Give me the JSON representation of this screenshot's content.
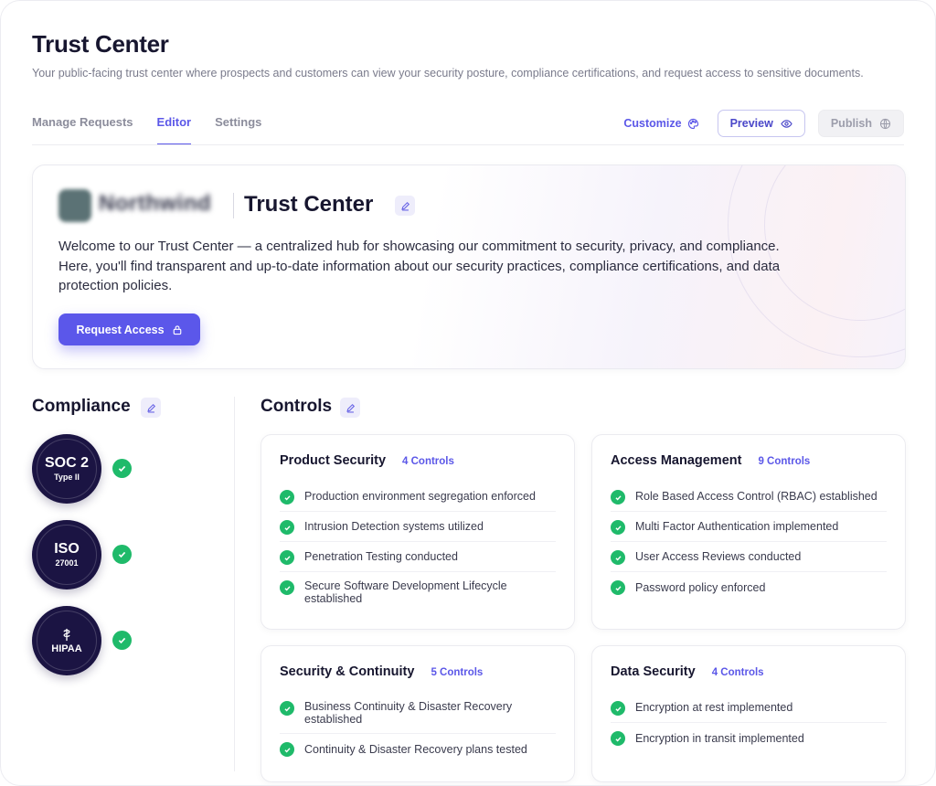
{
  "header": {
    "title": "Trust Center",
    "subtitle": "Your public-facing trust center where prospects and customers can view your security posture, compliance certifications, and request access to sensitive documents."
  },
  "tabs": [
    {
      "label": "Manage Requests",
      "active": false
    },
    {
      "label": "Editor",
      "active": true
    },
    {
      "label": "Settings",
      "active": false
    }
  ],
  "toolbar": {
    "customize_label": "Customize",
    "preview_label": "Preview",
    "publish_label": "Publish"
  },
  "hero": {
    "brand_name": "Northwind",
    "title": "Trust Center",
    "description": "Welcome to our Trust Center — a centralized hub for showcasing our commitment to security, privacy, and compliance. Here, you'll find transparent and up-to-date information about our security practices, compliance certifications, and data protection policies.",
    "cta_label": "Request Access"
  },
  "compliance": {
    "heading": "Compliance",
    "badges": [
      {
        "main": "SOC 2",
        "sub": "Type II",
        "verified": true
      },
      {
        "main": "ISO",
        "sub": "27001",
        "verified": true
      },
      {
        "main": "HIPAA",
        "sub": "",
        "verified": true
      }
    ]
  },
  "controls": {
    "heading": "Controls",
    "cards": [
      {
        "title": "Product Security",
        "count": "4 Controls",
        "items": [
          "Production environment segregation enforced",
          "Intrusion Detection systems utilized",
          "Penetration Testing conducted",
          "Secure Software Development Lifecycle established"
        ]
      },
      {
        "title": "Access Management",
        "count": "9 Controls",
        "items": [
          "Role Based Access Control (RBAC) established",
          "Multi Factor Authentication implemented",
          "User Access Reviews conducted",
          "Password policy enforced"
        ]
      },
      {
        "title": "Security & Continuity",
        "count": "5 Controls",
        "items": [
          "Business Continuity & Disaster Recovery established",
          "Continuity & Disaster Recovery plans tested"
        ]
      },
      {
        "title": "Data Security",
        "count": "4 Controls",
        "items": [
          "Encryption at rest implemented",
          "Encryption in transit implemented"
        ]
      }
    ]
  },
  "colors": {
    "accent": "#5b57e8",
    "badge_bg": "#1b1443",
    "success": "#1fba6a"
  },
  "icons": {
    "customize": "palette-icon",
    "preview": "eye-icon",
    "publish": "globe-icon",
    "edit": "pencil-icon",
    "cta": "lock-icon",
    "check": "check-circle-icon"
  }
}
